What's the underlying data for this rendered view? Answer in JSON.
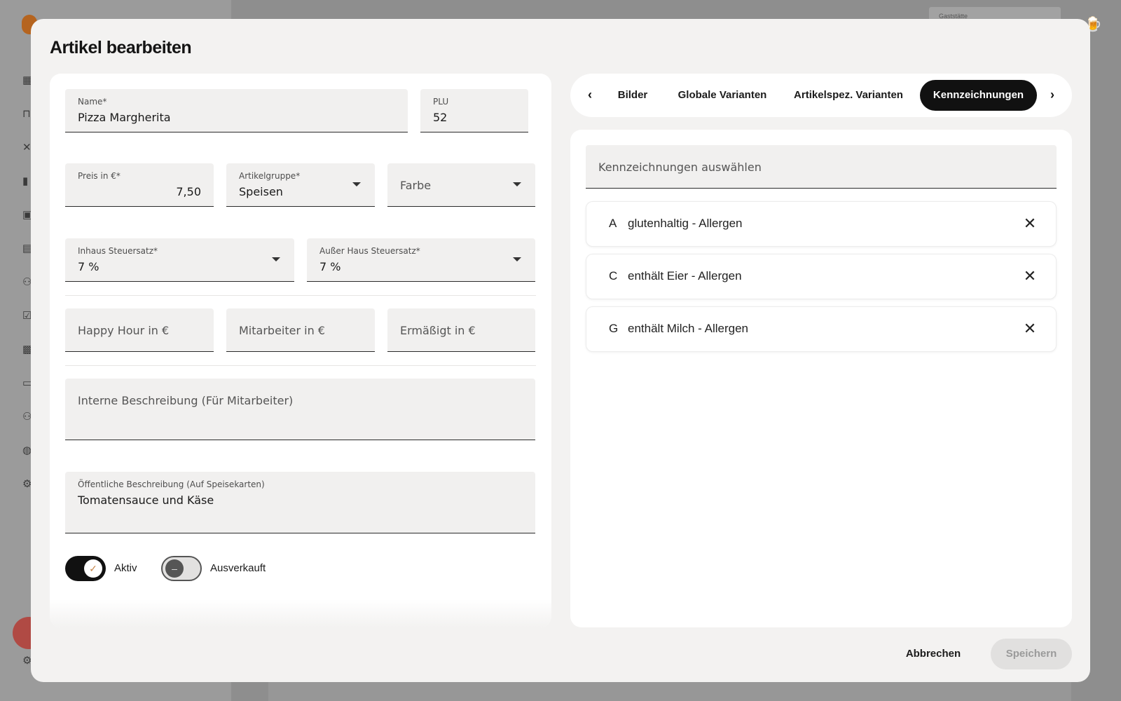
{
  "background": {
    "top_field_label": "Gaststätte"
  },
  "modal": {
    "title": "Artikel bearbeiten"
  },
  "form": {
    "name": {
      "label": "Name*",
      "value": "Pizza Margherita"
    },
    "plu": {
      "label": "PLU",
      "value": "52"
    },
    "price": {
      "label": "Preis in €*",
      "value": "7,50"
    },
    "article_group": {
      "label": "Artikelgruppe*",
      "value": "Speisen"
    },
    "color": {
      "placeholder": "Farbe"
    },
    "tax_inhouse": {
      "label": "Inhaus Steuersatz*",
      "value": "7 %"
    },
    "tax_outside": {
      "label": "Außer Haus Steuersatz*",
      "value": "7 %"
    },
    "happy_hour": {
      "placeholder": "Happy Hour in €"
    },
    "employee": {
      "placeholder": "Mitarbeiter in €"
    },
    "reduced": {
      "placeholder": "Ermäßigt in €"
    },
    "internal_description": {
      "placeholder": "Interne Beschreibung (Für Mitarbeiter)"
    },
    "public_description": {
      "label": "Öffentliche Beschreibung (Auf Speisekarten)",
      "value": "Tomatensauce und Käse"
    },
    "toggle_active": {
      "label": "Aktiv",
      "state": "on"
    },
    "toggle_sold_out": {
      "label": "Ausverkauft",
      "state": "off"
    }
  },
  "tabs": [
    {
      "label": "Bilder",
      "active": false
    },
    {
      "label": "Globale Varianten",
      "active": false
    },
    {
      "label": "Artikelspez. Varianten",
      "active": false
    },
    {
      "label": "Kennzeichnungen",
      "active": true
    }
  ],
  "labels_panel": {
    "select_placeholder": "Kennzeichnungen auswählen",
    "items": [
      {
        "code": "A",
        "text": "glutenhaltig - Allergen"
      },
      {
        "code": "C",
        "text": "enthält Eier - Allergen"
      },
      {
        "code": "G",
        "text": "enthält Milch - Allergen"
      }
    ]
  },
  "footer": {
    "cancel_label": "Abbrechen",
    "save_label": "Speichern"
  },
  "colors": {
    "accent_dark": "#111111",
    "toggle_check": "#c8864a",
    "save_disabled_bg": "#e1e0df"
  }
}
